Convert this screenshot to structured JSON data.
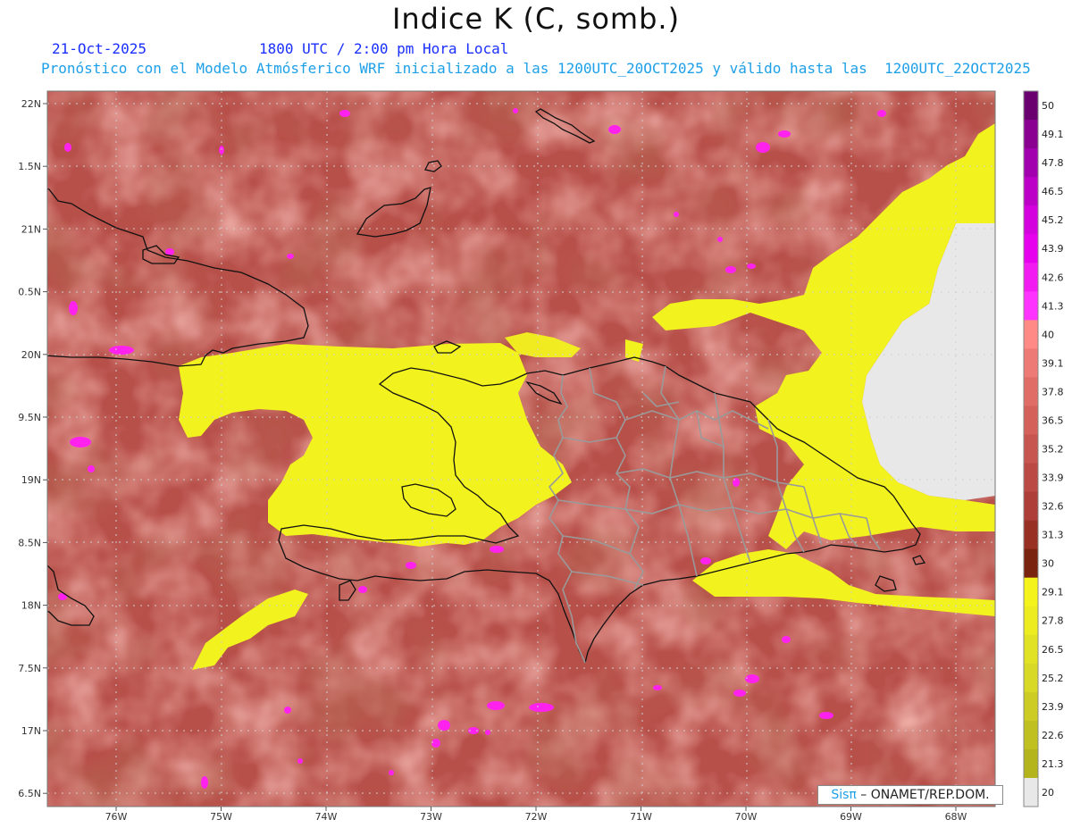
{
  "title": "Indice K (C, somb.)",
  "date_label": "21-Oct-2025",
  "time_label": "1800 UTC / 2:00 pm Hora Local",
  "model_info": "Pronóstico con el Modelo Atmósferico WRF inicializado a las 1200UTC_20OCT2025 y válido hasta las  1200UTC_22OCT2025",
  "credit": {
    "logo": "Sisπ",
    "text": " – ONAMET/REP.DOM."
  },
  "colors": {
    "background_field": "#b8504a",
    "low_yellow": "#f2f21e",
    "high_magenta": "#ff22ee",
    "missing": "#e8e8e8",
    "coast": "#111111",
    "provinces": "#9a9a9a"
  },
  "axes": {
    "lat_labels": [
      "22N",
      "1.5N",
      "21N",
      "0.5N",
      "20N",
      "9.5N",
      "19N",
      "8.5N",
      "18N",
      "7.5N",
      "17N",
      "6.5N"
    ],
    "lon_labels": [
      "76W",
      "75W",
      "74W",
      "73W",
      "72W",
      "71W",
      "70W",
      "69W",
      "68W"
    ]
  },
  "colorbar": {
    "labels": [
      "50",
      "49.1",
      "47.8",
      "46.5",
      "45.2",
      "43.9",
      "42.6",
      "41.3",
      "40",
      "39.1",
      "37.8",
      "36.5",
      "35.2",
      "33.9",
      "32.6",
      "31.3",
      "30",
      "29.1",
      "27.8",
      "26.5",
      "25.2",
      "23.9",
      "22.6",
      "21.3",
      "20"
    ],
    "colors": [
      "#6a0070",
      "#8a0090",
      "#a200ae",
      "#bc00c8",
      "#d400de",
      "#e600ee",
      "#f21cf2",
      "#ff33ff",
      "#ff8a86",
      "#ed7a74",
      "#e06e66",
      "#d4625a",
      "#c85650",
      "#bc4a44",
      "#ae3e38",
      "#983024",
      "#7a2410",
      "#f4f41c",
      "#ecec20",
      "#e2e224",
      "#d8d826",
      "#cccc24",
      "#c0c020",
      "#b4b41c",
      "#e8e8e8"
    ]
  }
}
